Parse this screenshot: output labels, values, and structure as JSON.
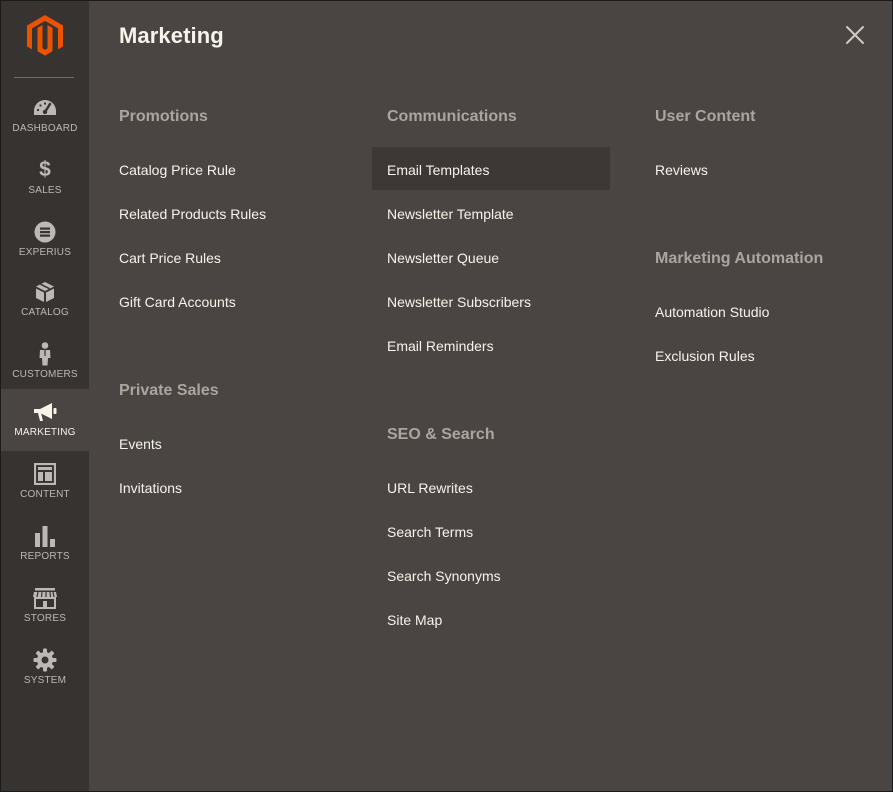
{
  "sidebar": {
    "logo_icon": "magento-logo-icon",
    "items": [
      {
        "label": "DASHBOARD",
        "icon": "dashboard-gauge-icon"
      },
      {
        "label": "SALES",
        "icon": "dollar-icon"
      },
      {
        "label": "EXPERIUS",
        "icon": "experius-icon"
      },
      {
        "label": "CATALOG",
        "icon": "box-icon"
      },
      {
        "label": "CUSTOMERS",
        "icon": "person-icon"
      },
      {
        "label": "MARKETING",
        "icon": "megaphone-icon",
        "active": true
      },
      {
        "label": "CONTENT",
        "icon": "layout-icon"
      },
      {
        "label": "REPORTS",
        "icon": "bar-chart-icon"
      },
      {
        "label": "STORES",
        "icon": "storefront-icon"
      },
      {
        "label": "SYSTEM",
        "icon": "gear-icon"
      }
    ]
  },
  "panel": {
    "title": "Marketing",
    "close_icon": "close-icon"
  },
  "promotions": {
    "title": "Promotions",
    "items": [
      "Catalog Price Rule",
      "Related Products Rules",
      "Cart Price Rules",
      "Gift Card Accounts"
    ]
  },
  "private_sales": {
    "title": "Private Sales",
    "items": [
      "Events",
      "Invitations"
    ]
  },
  "communications": {
    "title": "Communications",
    "items": [
      "Email Templates",
      "Newsletter Template",
      "Newsletter Queue",
      "Newsletter Subscribers",
      "Email Reminders"
    ]
  },
  "seo_search": {
    "title": "SEO & Search",
    "items": [
      "URL Rewrites",
      "Search Terms",
      "Search Synonyms",
      "Site Map"
    ]
  },
  "user_content": {
    "title": "User Content",
    "items": [
      "Reviews"
    ]
  },
  "marketing_automation": {
    "title": "Marketing Automation",
    "items": [
      "Automation Studio",
      "Exclusion Rules"
    ]
  },
  "colors": {
    "logo": "#eb5202",
    "sidebar_bg": "#373330",
    "panel_bg": "#4a4542",
    "text": "#f7f3eb",
    "section_title": "#aaa59e"
  }
}
